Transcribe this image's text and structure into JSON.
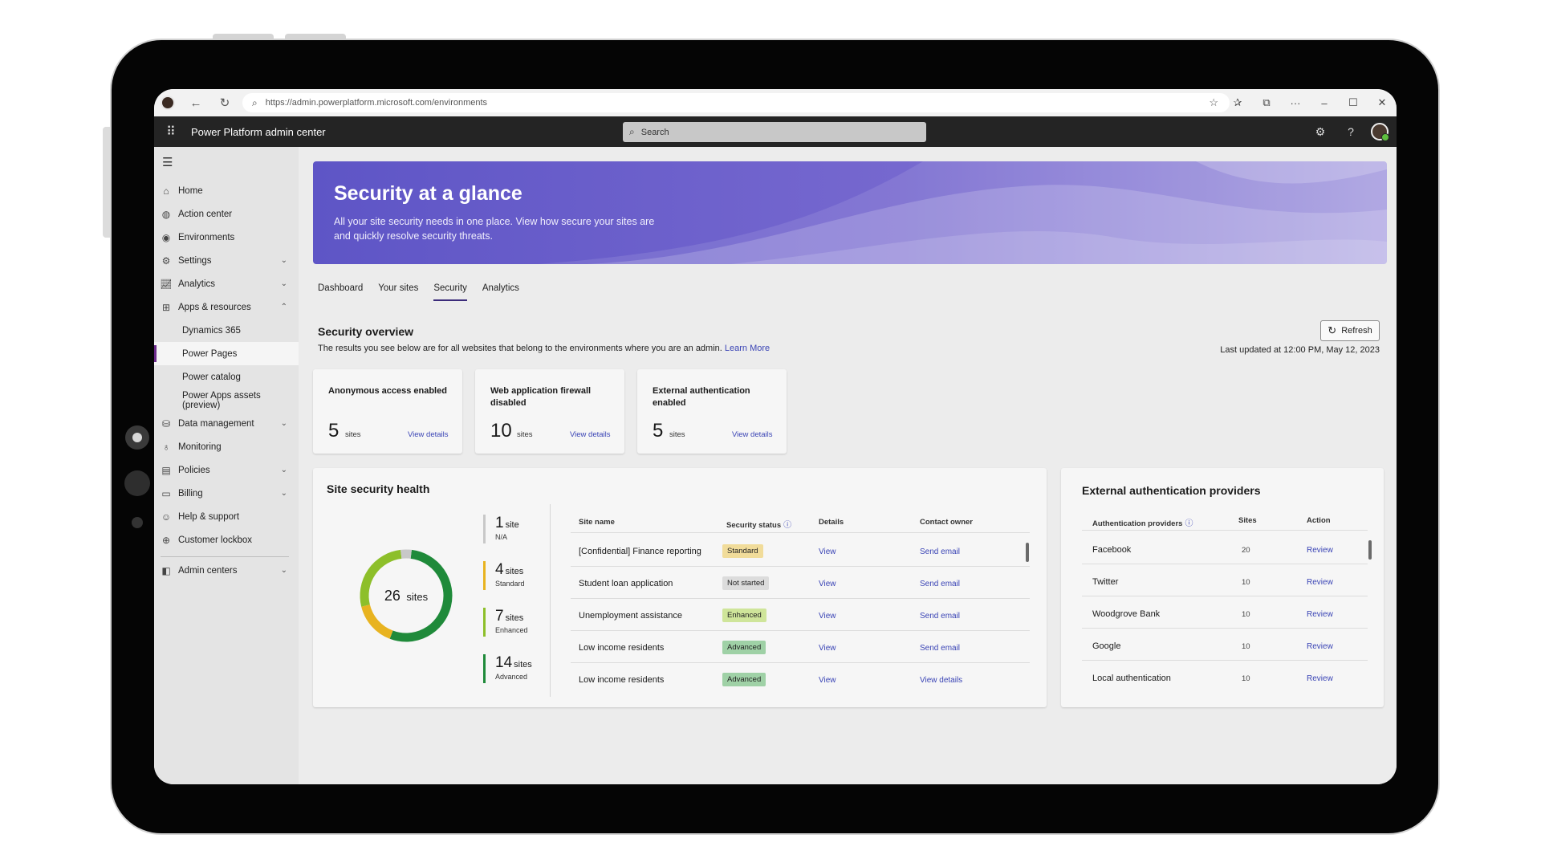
{
  "browser": {
    "url": "https://admin.powerplatform.microsoft.com/environments"
  },
  "app": {
    "title": "Power Platform admin center",
    "search_placeholder": "Search"
  },
  "sidebar": {
    "items": [
      {
        "label": "Home",
        "icon": "home-icon"
      },
      {
        "label": "Action center",
        "icon": "rocket-icon"
      },
      {
        "label": "Environments",
        "icon": "globe-icon"
      },
      {
        "label": "Settings",
        "icon": "gear-icon"
      },
      {
        "label": "Analytics",
        "icon": "chart-icon"
      },
      {
        "label": "Apps & resources",
        "icon": "apps-icon"
      },
      {
        "label": "Dynamics 365"
      },
      {
        "label": "Power Pages"
      },
      {
        "label": "Power catalog"
      },
      {
        "label": "Power Apps assets (preview)"
      },
      {
        "label": "Data management",
        "icon": "database-icon"
      },
      {
        "label": "Monitoring",
        "icon": "bulb-icon"
      },
      {
        "label": "Policies",
        "icon": "policy-icon"
      },
      {
        "label": "Billing",
        "icon": "billing-icon"
      },
      {
        "label": "Help & support",
        "icon": "help-icon"
      },
      {
        "label": "Customer lockbox",
        "icon": "lock-icon"
      },
      {
        "label": "Admin centers",
        "icon": "admin-icon"
      }
    ],
    "active": "Power Pages"
  },
  "hero": {
    "title": "Security at a glance",
    "subtitle": "All your site security needs in one place. View how secure your sites are and quickly resolve security threats."
  },
  "tabs": [
    "Dashboard",
    "Your sites",
    "Security",
    "Analytics"
  ],
  "active_tab": "Security",
  "overview": {
    "title": "Security overview",
    "description": "The results you see below are for all websites that belong to the environments where you are an admin.",
    "learn_more": "Learn More",
    "refresh": "Refresh",
    "last_updated": "Last updated at 12:00 PM, May 12, 2023"
  },
  "cards": [
    {
      "title": "Anonymous access enabled",
      "count": "5",
      "unit": "sites",
      "link": "View details"
    },
    {
      "title": "Web application firewall disabled",
      "count": "10",
      "unit": "sites",
      "link": "View details"
    },
    {
      "title": "External authentication enabled",
      "count": "5",
      "unit": "sites",
      "link": "View details"
    }
  ],
  "health": {
    "title": "Site security health",
    "total_number": "26",
    "total_unit": "sites",
    "legend": [
      {
        "num": "1",
        "unit": "site",
        "label": "N/A",
        "color": "#c8c8c8",
        "value": 1
      },
      {
        "num": "4",
        "unit": "sites",
        "label": "Standard",
        "color": "#e8b320",
        "value": 4
      },
      {
        "num": "7",
        "unit": "sites",
        "label": "Enhanced",
        "color": "#8dbf2a",
        "value": 7
      },
      {
        "num": "14",
        "unit": "sites",
        "label": "Advanced",
        "color": "#1f8a3a",
        "value": 14
      }
    ],
    "columns": [
      "Site name",
      "Security status",
      "Details",
      "Contact owner"
    ],
    "rows": [
      {
        "name": "[Confidential] Finance reporting",
        "status": "Standard",
        "status_color": "#f1dc9a",
        "details": "View",
        "contact": "Send email"
      },
      {
        "name": "Student loan application",
        "status": "Not started",
        "status_color": "#dcdcdc",
        "details": "View",
        "contact": "Send email"
      },
      {
        "name": "Unemployment assistance",
        "status": "Enhanced",
        "status_color": "#cfe59a",
        "details": "View",
        "contact": "Send email"
      },
      {
        "name": "Low income residents",
        "status": "Advanced",
        "status_color": "#9fd1a6",
        "details": "View",
        "contact": "Send email"
      },
      {
        "name": "Low income residents",
        "status": "Advanced",
        "status_color": "#9fd1a6",
        "details": "View",
        "contact": "View details"
      }
    ]
  },
  "providers": {
    "title": "External authentication providers",
    "columns": [
      "Authentication providers",
      "Sites",
      "Action"
    ],
    "rows": [
      {
        "name": "Facebook",
        "sites": "20",
        "action": "Review"
      },
      {
        "name": "Twitter",
        "sites": "10",
        "action": "Review"
      },
      {
        "name": "Woodgrove Bank",
        "sites": "10",
        "action": "Review"
      },
      {
        "name": "Google",
        "sites": "10",
        "action": "Review"
      },
      {
        "name": "Local authentication",
        "sites": "10",
        "action": "Review"
      }
    ]
  }
}
